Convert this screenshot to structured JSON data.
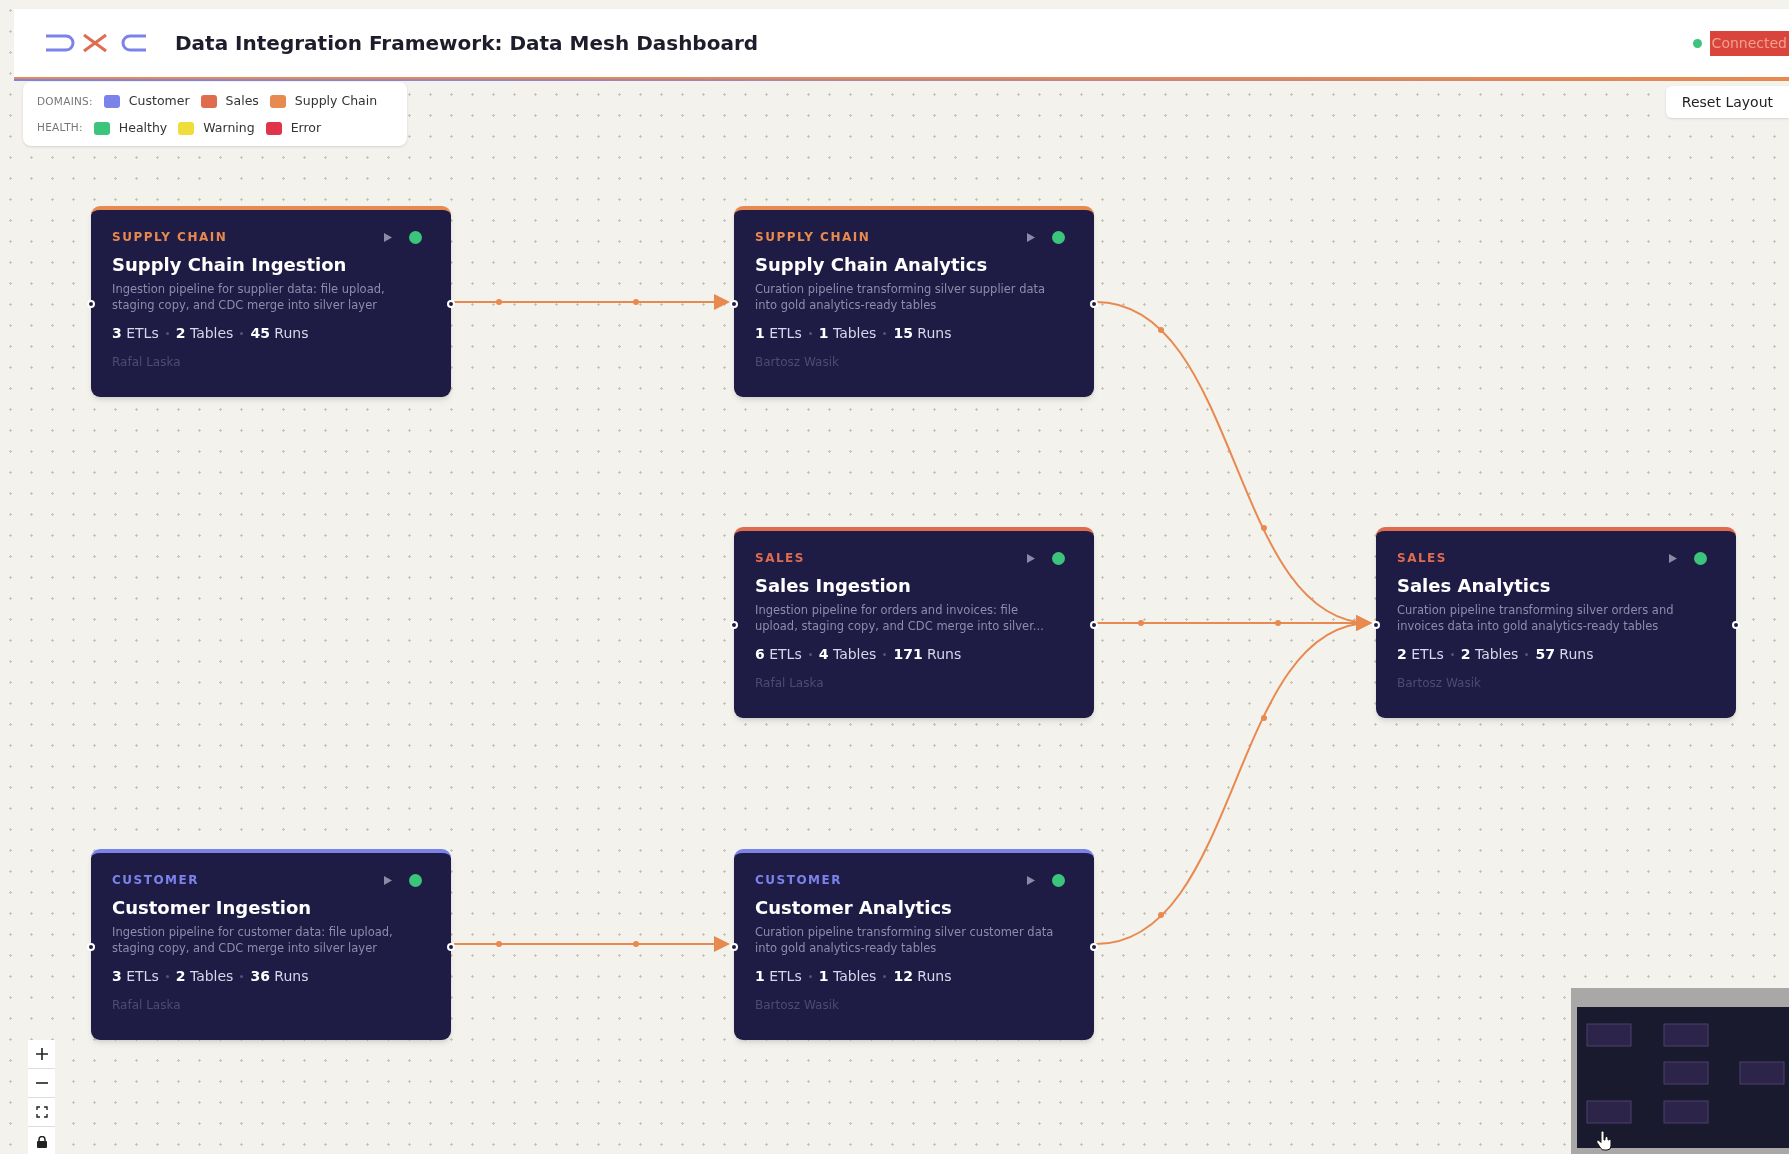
{
  "header": {
    "title": "Data Integration Framework: Data Mesh Dashboard",
    "connection": {
      "label": "Connected",
      "color": "#3cc47c"
    }
  },
  "legend": {
    "domains_label": "DOMAINS:",
    "domains": [
      {
        "label": "Customer",
        "color": "#7b83eb"
      },
      {
        "label": "Sales",
        "color": "#e06c4f"
      },
      {
        "label": "Supply Chain",
        "color": "#e8894f"
      }
    ],
    "health_label": "HEALTH:",
    "health": [
      {
        "label": "Healthy",
        "color": "#3cc47c"
      },
      {
        "label": "Warning",
        "color": "#f0dc3a"
      },
      {
        "label": "Error",
        "color": "#e0344b"
      }
    ]
  },
  "reset_button": "Reset Layout",
  "nodes": [
    {
      "kind": "supply",
      "domain": "SUPPLY CHAIN",
      "title": "Supply Chain Ingestion",
      "description": "Ingestion pipeline for supplier data: file upload, staging copy, and CDC merge into silver layer",
      "stats": [
        "**3** ETLs",
        "**2** Tables",
        "**45** Runs"
      ],
      "owner": "Rafal Laska",
      "color": "#3cc47c"
    },
    {
      "kind": "supply",
      "domain": "SUPPLY CHAIN",
      "title": "Supply Chain Analytics",
      "description": "Curation pipeline transforming silver supplier data into gold analytics-ready tables",
      "stats": [
        "**1** ETLs",
        "**1** Tables",
        "**15** Runs"
      ],
      "owner": "Bartosz Wasik",
      "color": "#3cc47c"
    },
    {
      "kind": "sales",
      "domain": "SALES",
      "title": "Sales Ingestion",
      "description": "Ingestion pipeline for orders and invoices: file upload, staging copy, and CDC merge into silver...",
      "stats": [
        "**6** ETLs",
        "**4** Tables",
        "**171** Runs"
      ],
      "owner": "Rafal Laska",
      "color": "#3cc47c"
    },
    {
      "kind": "sales",
      "domain": "SALES",
      "title": "Sales Analytics",
      "description": "Curation pipeline transforming silver orders and invoices data into gold analytics-ready tables",
      "stats": [
        "**2** ETLs",
        "**2** Tables",
        "**57** Runs"
      ],
      "owner": "Bartosz Wasik",
      "color": "#3cc47c"
    },
    {
      "kind": "customer",
      "domain": "CUSTOMER",
      "title": "Customer Ingestion",
      "description": "Ingestion pipeline for customer data: file upload, staging copy, and CDC merge into silver layer",
      "stats": [
        "**3** ETLs",
        "**2** Tables",
        "**36** Runs"
      ],
      "owner": "Rafal Laska",
      "color": "#3cc47c"
    },
    {
      "kind": "customer",
      "domain": "CUSTOMER",
      "title": "Customer Analytics",
      "description": "Curation pipeline transforming silver customer data into gold analytics-ready tables",
      "stats": [
        "**1** ETLs",
        "**1** Tables",
        "**12** Runs"
      ],
      "owner": "Bartosz Wasik",
      "color": "#3cc47c"
    }
  ]
}
